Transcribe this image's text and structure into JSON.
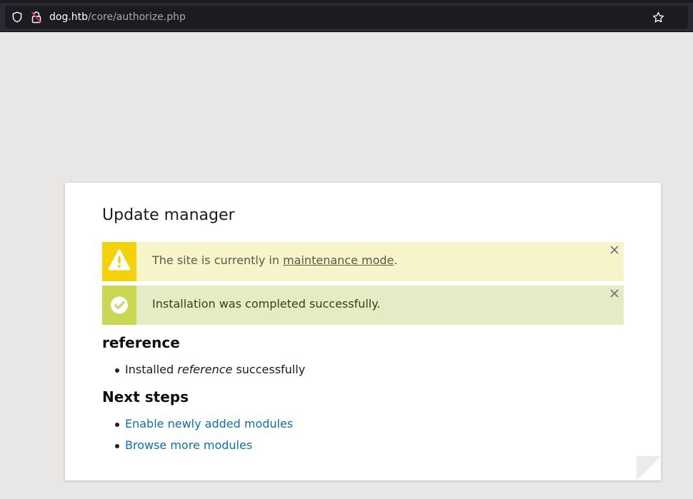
{
  "browser": {
    "url_host": "dog.htb",
    "url_path": "/core/authorize.php"
  },
  "page": {
    "title": "Update manager",
    "messages": [
      {
        "type": "warning",
        "text_before": "The site is currently in ",
        "link": "maintenance mode",
        "text_after": ".",
        "icon": "warning-icon",
        "color": "#f3d20c"
      },
      {
        "type": "status",
        "text": "Installation was completed successfully.",
        "icon": "check-icon",
        "color": "#cad753"
      }
    ],
    "section_module": {
      "heading": "reference",
      "item_before": "Installed ",
      "item_emph": "reference",
      "item_after": " successfully"
    },
    "section_next": {
      "heading": "Next steps",
      "links": [
        "Enable newly added modules",
        "Browse more modules"
      ]
    }
  },
  "colors": {
    "link": "#0b72b0",
    "background": "#e8e7e5",
    "toolbar": "#2b2a33"
  }
}
